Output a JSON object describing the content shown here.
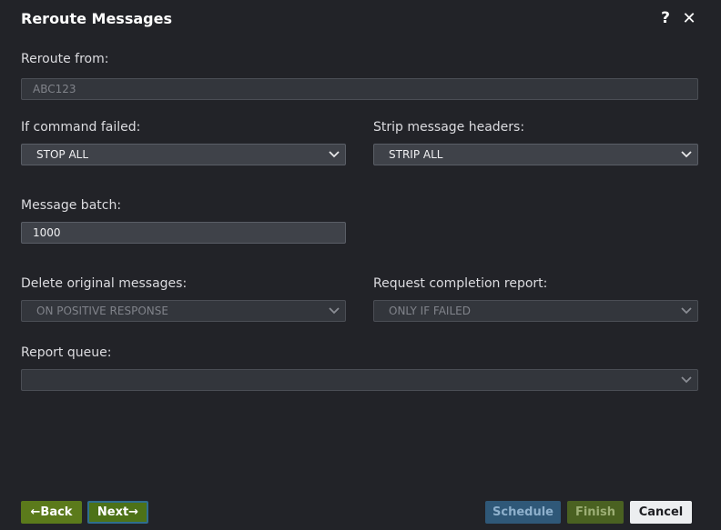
{
  "dialog": {
    "title": "Reroute Messages",
    "help_icon": "?",
    "close_icon": "✕"
  },
  "form": {
    "reroute_from": {
      "label": "Reroute from:",
      "value": "ABC123",
      "disabled": true
    },
    "command_failed": {
      "label": "If command failed:",
      "value": "STOP ALL"
    },
    "strip_headers": {
      "label": "Strip message headers:",
      "value": "STRIP ALL"
    },
    "message_batch": {
      "label": "Message batch:",
      "value": "1000"
    },
    "delete_original": {
      "label": "Delete original messages:",
      "value": "ON POSITIVE RESPONSE",
      "disabled": true
    },
    "completion_report": {
      "label": "Request completion report:",
      "value": "ONLY IF FAILED",
      "disabled": true
    },
    "report_queue": {
      "label": "Report queue:",
      "value": "",
      "disabled": true
    }
  },
  "footer": {
    "back_label": "←Back",
    "next_label": "Next→",
    "schedule_label": "Schedule",
    "finish_label": "Finish",
    "cancel_label": "Cancel"
  },
  "icons": {
    "help": "question-icon",
    "close": "close-icon",
    "dropdown": "chevron-down-icon"
  },
  "colors": {
    "background": "#222328",
    "field": "#3f4249",
    "back_button": "#5b7a1b",
    "next_button": "#4d7218",
    "schedule_button": "#2f5878",
    "finish_button": "#4a6121",
    "cancel_button": "#eceef0"
  }
}
